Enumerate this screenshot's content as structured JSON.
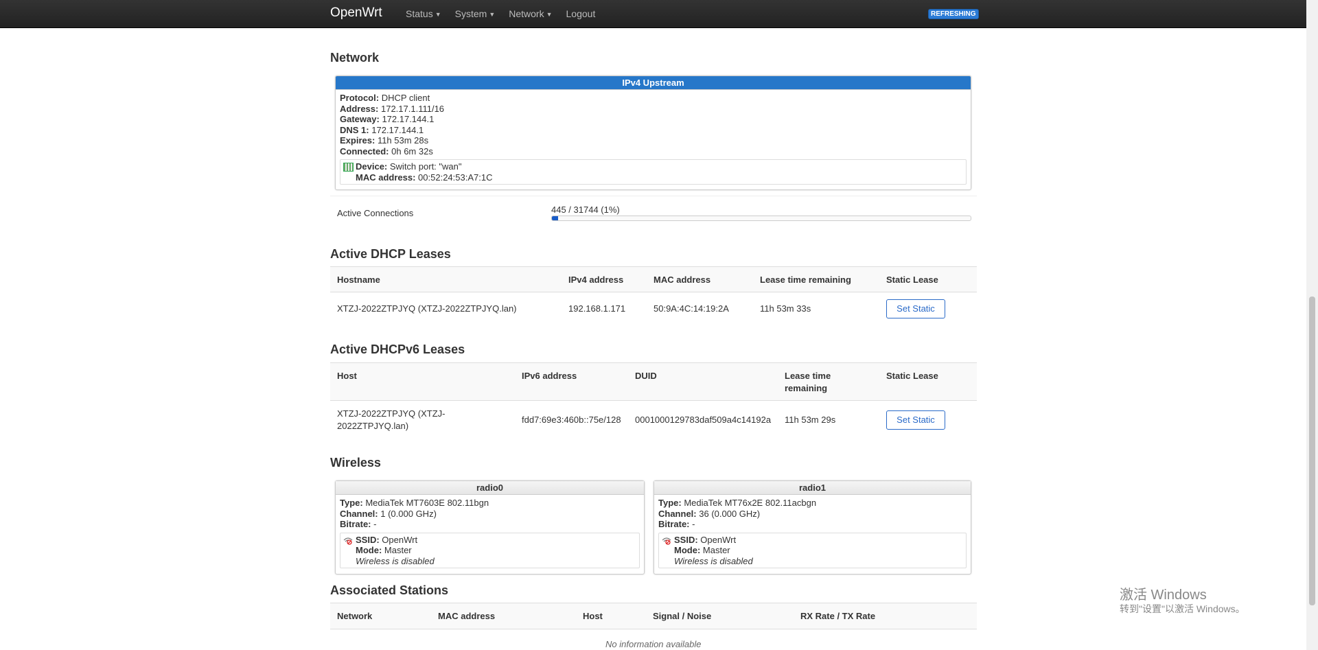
{
  "navbar": {
    "brand": "OpenWrt",
    "menu": [
      "Status",
      "System",
      "Network",
      "Logout"
    ],
    "badge": "REFRESHING"
  },
  "network": {
    "title": "Network",
    "upstream": {
      "header": "IPv4 Upstream",
      "protocol_label": "Protocol:",
      "protocol": "DHCP client",
      "address_label": "Address:",
      "address": "172.17.1.111/16",
      "gateway_label": "Gateway:",
      "gateway": "172.17.144.1",
      "dns_label": "DNS 1:",
      "dns": "172.17.144.1",
      "expires_label": "Expires:",
      "expires": "11h 53m 28s",
      "connected_label": "Connected:",
      "connected": "0h 6m 32s",
      "device_label": "Device:",
      "device": "Switch port: \"wan\"",
      "mac_label": "MAC address:",
      "mac": "00:52:24:53:A7:1C"
    },
    "active_connections": {
      "label": "Active Connections",
      "value": "445 / 31744 (1%)",
      "fraction": 0.014
    }
  },
  "dhcp": {
    "title": "Active DHCP Leases",
    "headers": [
      "Hostname",
      "IPv4 address",
      "MAC address",
      "Lease time remaining",
      "Static Lease"
    ],
    "row": {
      "hostname": "XTZJ-2022ZTPJYQ (XTZJ-2022ZTPJYQ.lan)",
      "ip": "192.168.1.171",
      "mac": "50:9A:4C:14:19:2A",
      "lease": "11h 53m 33s",
      "button": "Set Static"
    }
  },
  "dhcpv6": {
    "title": "Active DHCPv6 Leases",
    "headers": [
      "Host",
      "IPv6 address",
      "DUID",
      "Lease time",
      "remaining",
      "Static Lease"
    ],
    "row": {
      "host_line1": "XTZJ-2022ZTPJYQ (XTZJ-",
      "host_line2": "2022ZTPJYQ.lan)",
      "ip": "fdd7:69e3:460b::75e/128",
      "duid": "0001000129783daf509a4c14192a",
      "lease": "11h 53m 29s",
      "button": "Set Static"
    }
  },
  "wireless": {
    "title": "Wireless",
    "radios": [
      {
        "name": "radio0",
        "type_label": "Type:",
        "type": "MediaTek MT7603E 802.11bgn",
        "channel_label": "Channel:",
        "channel": "1 (0.000 GHz)",
        "bitrate_label": "Bitrate:",
        "bitrate": "-",
        "ssid_label": "SSID:",
        "ssid": "OpenWrt",
        "mode_label": "Mode:",
        "mode": "Master",
        "status": "Wireless is disabled"
      },
      {
        "name": "radio1",
        "type_label": "Type:",
        "type": "MediaTek MT76x2E 802.11acbgn",
        "channel_label": "Channel:",
        "channel": "36 (0.000 GHz)",
        "bitrate_label": "Bitrate:",
        "bitrate": "-",
        "ssid_label": "SSID:",
        "ssid": "OpenWrt",
        "mode_label": "Mode:",
        "mode": "Master",
        "status": "Wireless is disabled"
      }
    ]
  },
  "stations": {
    "title": "Associated Stations",
    "headers": [
      "Network",
      "MAC address",
      "Host",
      "Signal / Noise",
      "RX Rate / TX Rate"
    ],
    "empty": "No information available"
  },
  "watermark": {
    "line1": "激活 Windows",
    "line2": "转到\"设置\"以激活 Windows。"
  }
}
